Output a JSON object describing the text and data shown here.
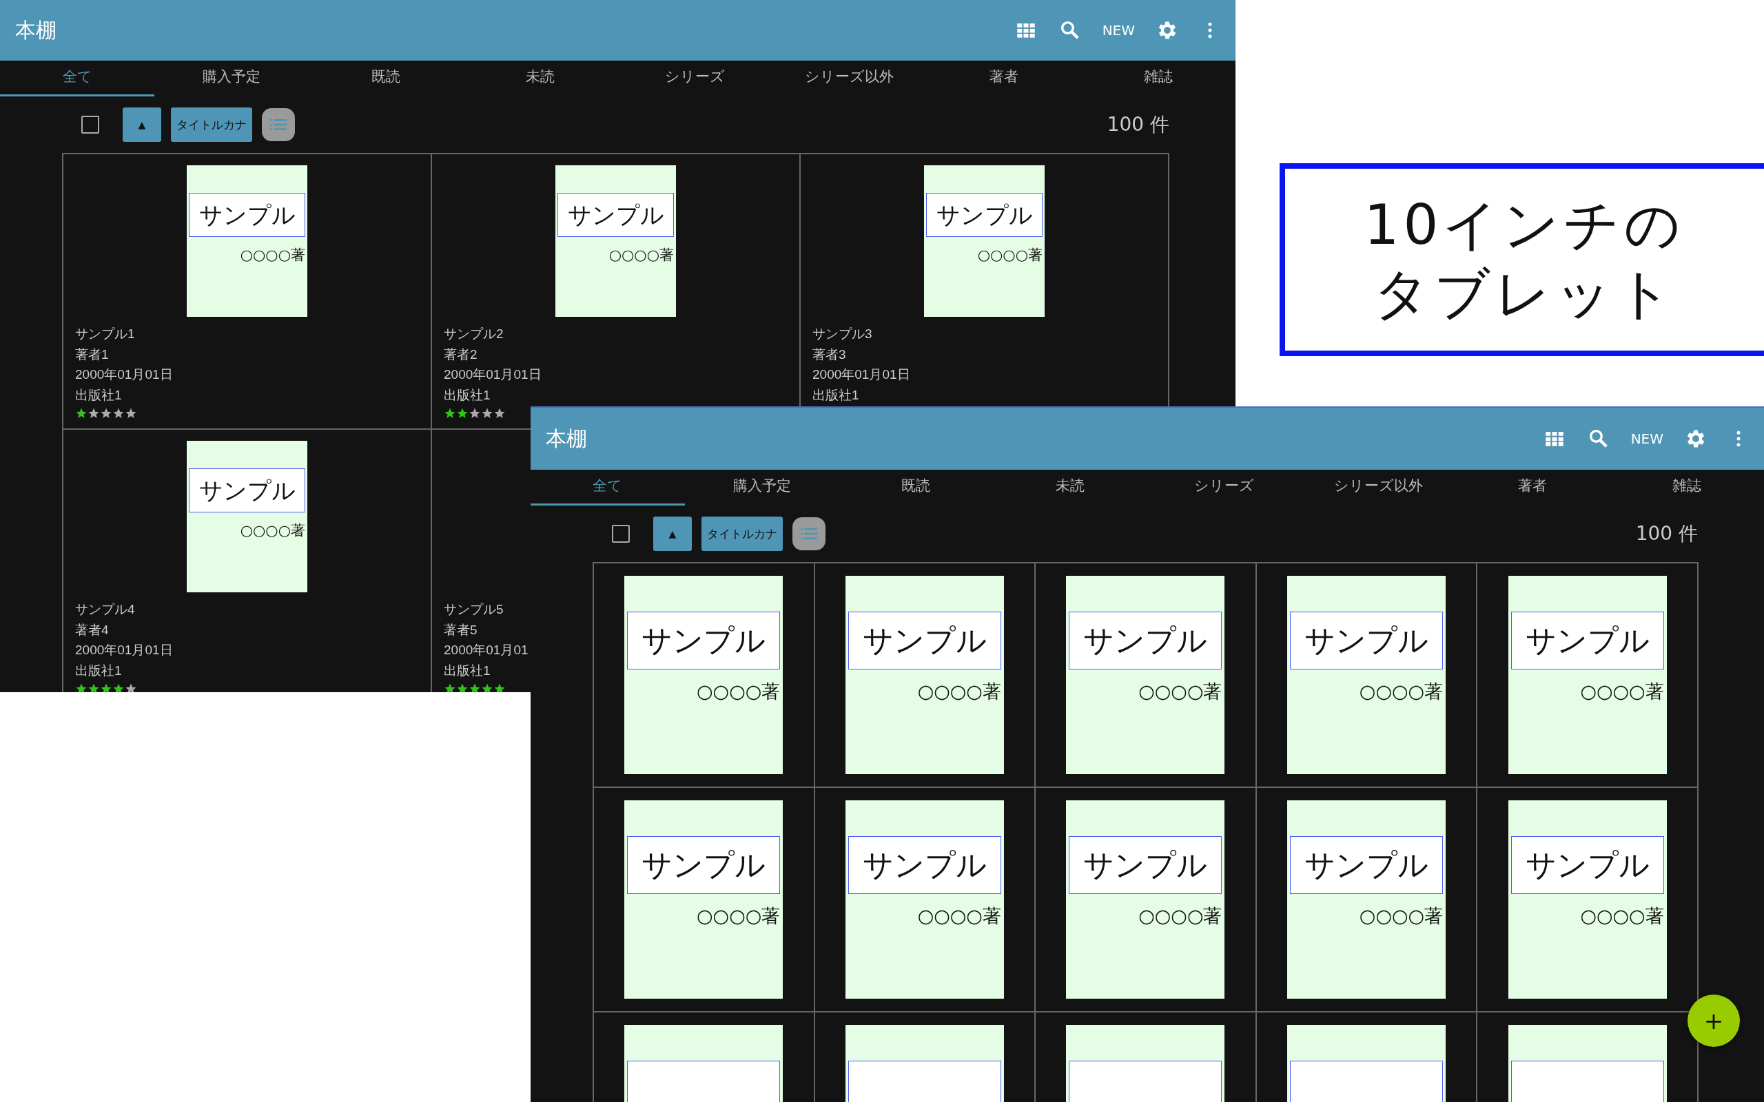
{
  "windows": [
    {
      "kind": "detail-grid",
      "title": "本棚",
      "actions": {
        "new": "NEW"
      },
      "tabs": [
        {
          "label": "全て",
          "selected": true
        },
        {
          "label": "購入予定",
          "selected": false
        },
        {
          "label": "既読",
          "selected": false
        },
        {
          "label": "未読",
          "selected": false
        },
        {
          "label": "シリーズ",
          "selected": false
        },
        {
          "label": "シリーズ以外",
          "selected": false
        },
        {
          "label": "著者",
          "selected": false
        },
        {
          "label": "雑誌",
          "selected": false
        }
      ],
      "toolbar": {
        "checked": false,
        "sort_order": "▲",
        "sort_key": "タイトルカナ",
        "count": "100 件"
      },
      "books": [
        {
          "kind": "full",
          "cover_title": "サンプル",
          "cover_author": "○○○○著",
          "title": "サンプル1",
          "author": "著者1",
          "date": "2000年01月01日",
          "publisher": "出版社1",
          "stars": 1
        },
        {
          "kind": "full",
          "cover_title": "サンプル",
          "cover_author": "○○○○著",
          "title": "サンプル2",
          "author": "著者2",
          "date": "2000年01月01日",
          "publisher": "出版社1",
          "stars": 2
        },
        {
          "kind": "full",
          "cover_title": "サンプル",
          "cover_author": "○○○○著",
          "title": "サンプル3",
          "author": "著者3",
          "date": "2000年01月01日",
          "publisher": "出版社1"
        },
        {
          "kind": "full",
          "cover_title": "サンプル",
          "cover_author": "○○○○著",
          "title": "サンプル4",
          "author": "著者4",
          "date": "2000年01月01日",
          "publisher": "出版社1",
          "stars": 4
        },
        {
          "kind": "text-only",
          "title": "サンプル5",
          "author": "著者5",
          "date": "2000年01月01",
          "publisher": "出版社1",
          "stars": 5
        }
      ]
    },
    {
      "kind": "cover-grid",
      "title": "本棚",
      "actions": {
        "new": "NEW"
      },
      "tabs": [
        {
          "label": "全て",
          "selected": true
        },
        {
          "label": "購入予定",
          "selected": false
        },
        {
          "label": "既読",
          "selected": false
        },
        {
          "label": "未読",
          "selected": false
        },
        {
          "label": "シリーズ",
          "selected": false
        },
        {
          "label": "シリーズ以外",
          "selected": false
        },
        {
          "label": "著者",
          "selected": false
        },
        {
          "label": "雑誌",
          "selected": false
        }
      ],
      "toolbar": {
        "checked": false,
        "sort_order": "▲",
        "sort_key": "タイトルカナ",
        "count": "100 件"
      },
      "books": [
        {
          "cover_title": "サンプル",
          "cover_author": "○○○○著"
        },
        {
          "cover_title": "サンプル",
          "cover_author": "○○○○著"
        },
        {
          "cover_title": "サンプル",
          "cover_author": "○○○○著"
        },
        {
          "cover_title": "サンプル",
          "cover_author": "○○○○著"
        },
        {
          "cover_title": "サンプル",
          "cover_author": "○○○○著"
        },
        {
          "cover_title": "サンプル",
          "cover_author": "○○○○著"
        },
        {
          "cover_title": "サンプル",
          "cover_author": "○○○○著"
        },
        {
          "cover_title": "サンプル",
          "cover_author": "○○○○著"
        },
        {
          "cover_title": "サンプル",
          "cover_author": "○○○○著"
        },
        {
          "cover_title": "サンプル",
          "cover_author": "○○○○著"
        },
        {
          "kind": "cover-top"
        },
        {
          "kind": "cover-top"
        },
        {
          "kind": "cover-top"
        },
        {
          "kind": "cover-top"
        },
        {
          "kind": "cover-top"
        }
      ],
      "fab": "+"
    }
  ],
  "caption": [
    "10インチの",
    "タブレット"
  ]
}
